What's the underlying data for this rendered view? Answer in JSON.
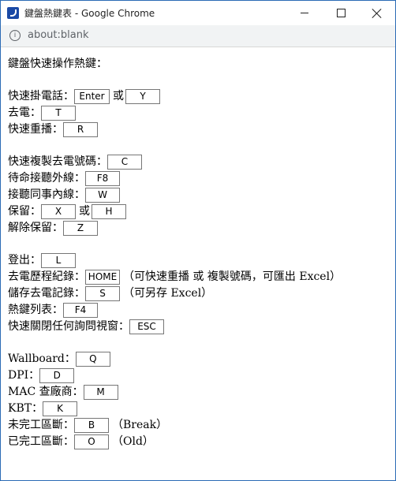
{
  "window": {
    "title": "鍵盤熱鍵表 - Google Chrome",
    "url": "about:blank"
  },
  "heading": "鍵盤快速操作熱鍵：",
  "groups": [
    {
      "rows": [
        {
          "label": "快速掛電話：",
          "keys": [
            {
              "value": "Enter",
              "w": 45
            },
            {
              "value": "Y",
              "w": 44
            }
          ],
          "sep": "或"
        },
        {
          "label": "去電：",
          "keys": [
            {
              "value": "T",
              "w": 44
            }
          ]
        },
        {
          "label": "快速重播：",
          "keys": [
            {
              "value": "R",
              "w": 44
            }
          ]
        }
      ]
    },
    {
      "rows": [
        {
          "label": "快速複製去電號碼：",
          "keys": [
            {
              "value": "C",
              "w": 44
            }
          ]
        },
        {
          "label": "待命接聽外線：",
          "keys": [
            {
              "value": "F8",
              "w": 44
            }
          ]
        },
        {
          "label": "接聽同事內線：",
          "keys": [
            {
              "value": "W",
              "w": 44
            }
          ]
        },
        {
          "label": "保留：",
          "keys": [
            {
              "value": "X",
              "w": 44
            },
            {
              "value": "H",
              "w": 44
            }
          ],
          "sep": "或"
        },
        {
          "label": "解除保留：",
          "keys": [
            {
              "value": "Z",
              "w": 44
            }
          ]
        }
      ]
    },
    {
      "rows": [
        {
          "label": "登出：",
          "keys": [
            {
              "value": "L",
              "w": 44
            }
          ]
        },
        {
          "label": "去電歷程紀錄：",
          "keys": [
            {
              "value": "HOME",
              "w": 44
            }
          ],
          "note": "（可快速重播 或 複製號碼，可匯出 Excel）"
        },
        {
          "label": "儲存去電記錄：",
          "keys": [
            {
              "value": "S",
              "w": 44
            }
          ],
          "note": "（可另存 Excel）"
        },
        {
          "label": "熱鍵列表：",
          "keys": [
            {
              "value": "F4",
              "w": 44
            }
          ]
        },
        {
          "label": "快速關閉任何詢問視窗：",
          "keys": [
            {
              "value": "ESC",
              "w": 44
            }
          ]
        }
      ]
    },
    {
      "rows": [
        {
          "label": "Wallboard：",
          "keys": [
            {
              "value": "Q",
              "w": 44
            }
          ]
        },
        {
          "label": "DPI：",
          "keys": [
            {
              "value": "D",
              "w": 44
            }
          ]
        },
        {
          "label": "MAC 查廠商：",
          "keys": [
            {
              "value": "M",
              "w": 44
            }
          ]
        },
        {
          "label": "KBT：",
          "keys": [
            {
              "value": "K",
              "w": 44
            }
          ]
        },
        {
          "label": "未完工區斷：",
          "keys": [
            {
              "value": "B",
              "w": 44
            }
          ],
          "note": "（Break）"
        },
        {
          "label": "已完工區斷：",
          "keys": [
            {
              "value": "O",
              "w": 44
            }
          ],
          "note": "（Old）"
        }
      ]
    }
  ]
}
